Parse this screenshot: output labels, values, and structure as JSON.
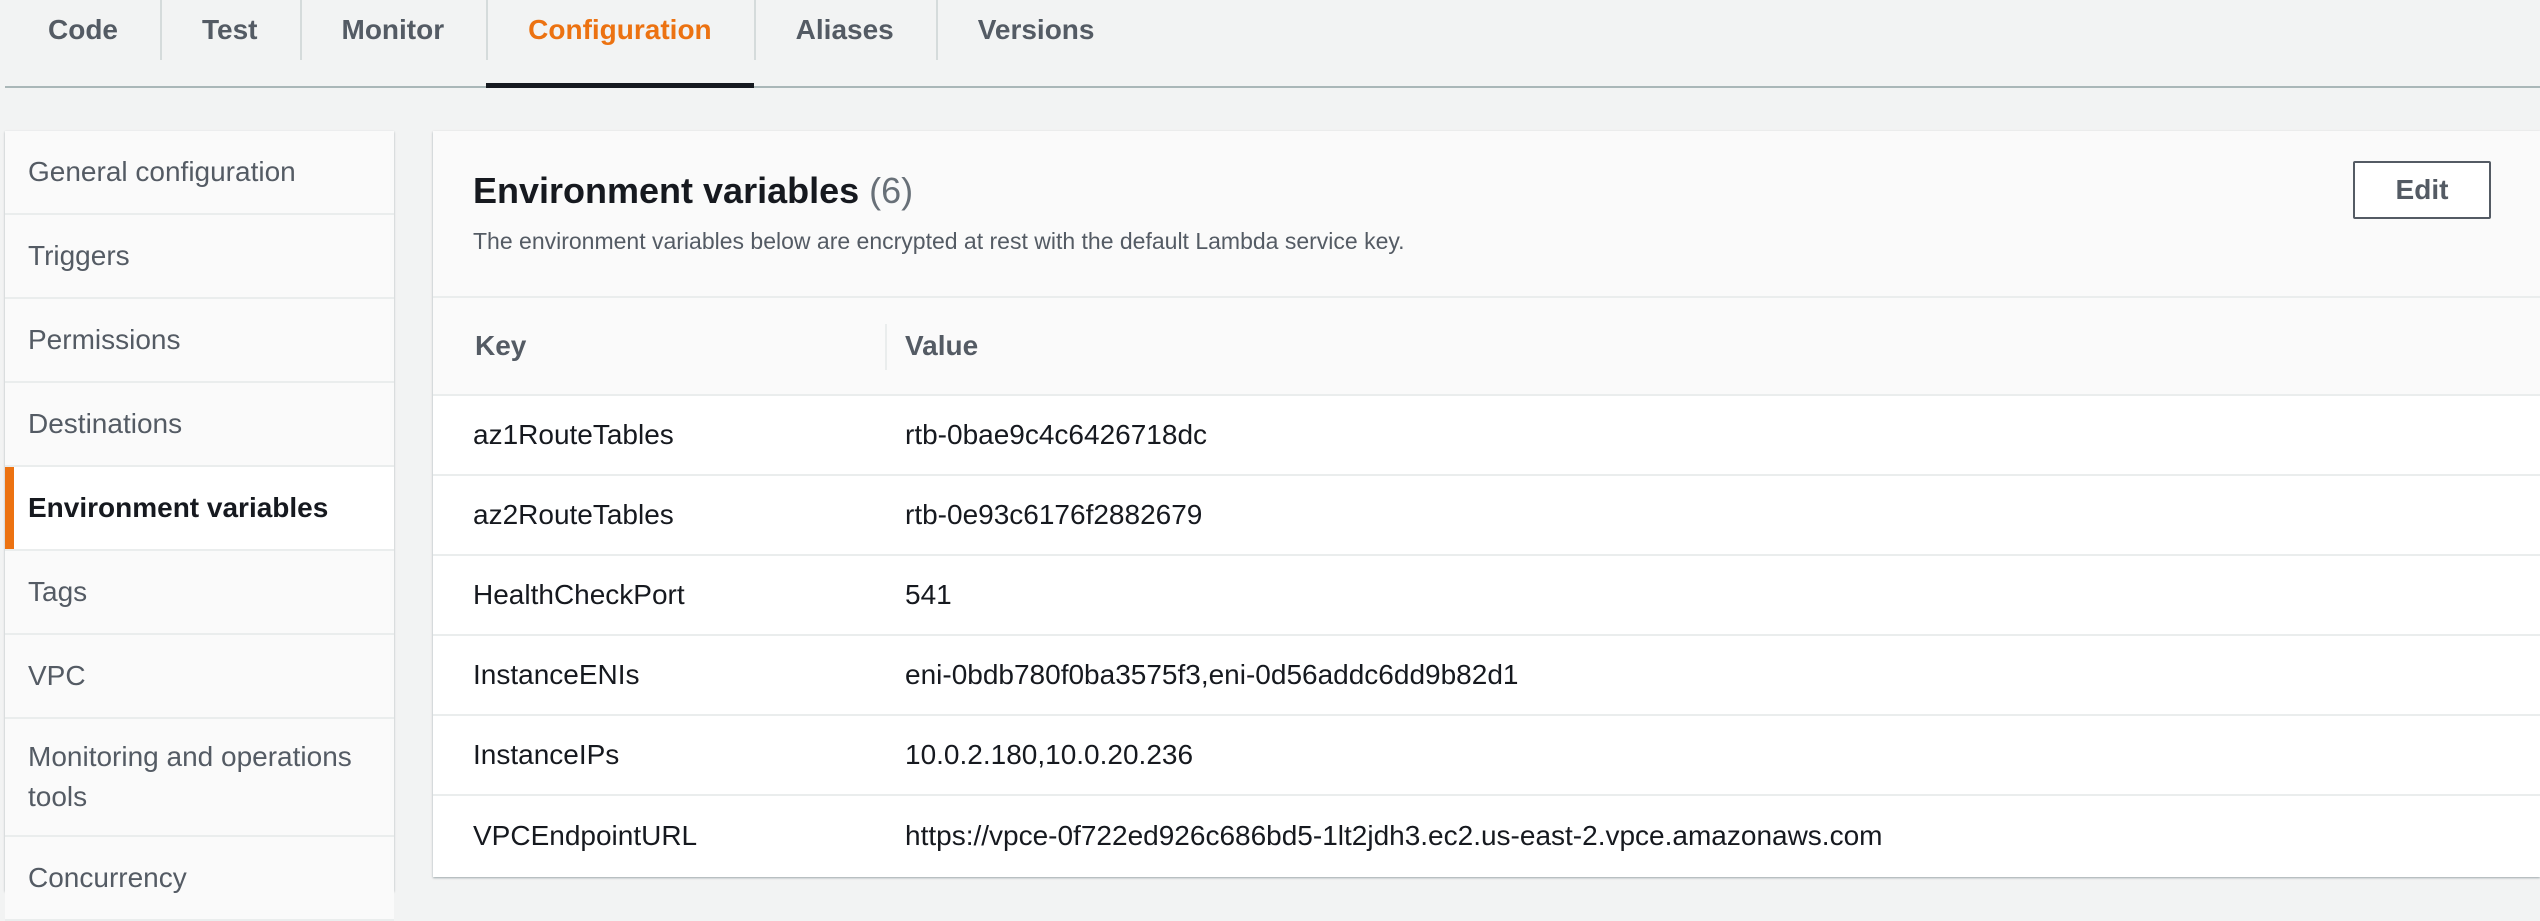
{
  "tabs": [
    {
      "label": "Code",
      "active": false
    },
    {
      "label": "Test",
      "active": false
    },
    {
      "label": "Monitor",
      "active": false
    },
    {
      "label": "Configuration",
      "active": true
    },
    {
      "label": "Aliases",
      "active": false
    },
    {
      "label": "Versions",
      "active": false
    }
  ],
  "sidenav": {
    "items": [
      {
        "label": "General configuration"
      },
      {
        "label": "Triggers"
      },
      {
        "label": "Permissions"
      },
      {
        "label": "Destinations"
      },
      {
        "label": "Environment variables",
        "active": true
      },
      {
        "label": "Tags"
      },
      {
        "label": "VPC"
      },
      {
        "label": "Monitoring and operations tools"
      },
      {
        "label": "Concurrency"
      }
    ]
  },
  "panel": {
    "title": "Environment variables",
    "count": "(6)",
    "description": "The environment variables below are encrypted at rest with the default Lambda service key.",
    "edit_label": "Edit"
  },
  "table": {
    "headers": {
      "key": "Key",
      "value": "Value"
    },
    "rows": [
      {
        "key": "az1RouteTables",
        "value": "rtb-0bae9c4c6426718dc"
      },
      {
        "key": "az2RouteTables",
        "value": "rtb-0e93c6176f2882679"
      },
      {
        "key": "HealthCheckPort",
        "value": "541"
      },
      {
        "key": "InstanceENIs",
        "value": "eni-0bdb780f0ba3575f3,eni-0d56addc6dd9b82d1"
      },
      {
        "key": "InstanceIPs",
        "value": "10.0.2.180,10.0.20.236"
      },
      {
        "key": "VPCEndpointURL",
        "value": "https://vpce-0f722ed926c686bd5-1lt2jdh3.ec2.us-east-2.vpce.amazonaws.com"
      }
    ]
  },
  "colors": {
    "accent": "#ec7211",
    "text": "#16191f",
    "muted": "#545b64",
    "background": "#f2f3f3",
    "border": "#eaeded"
  }
}
